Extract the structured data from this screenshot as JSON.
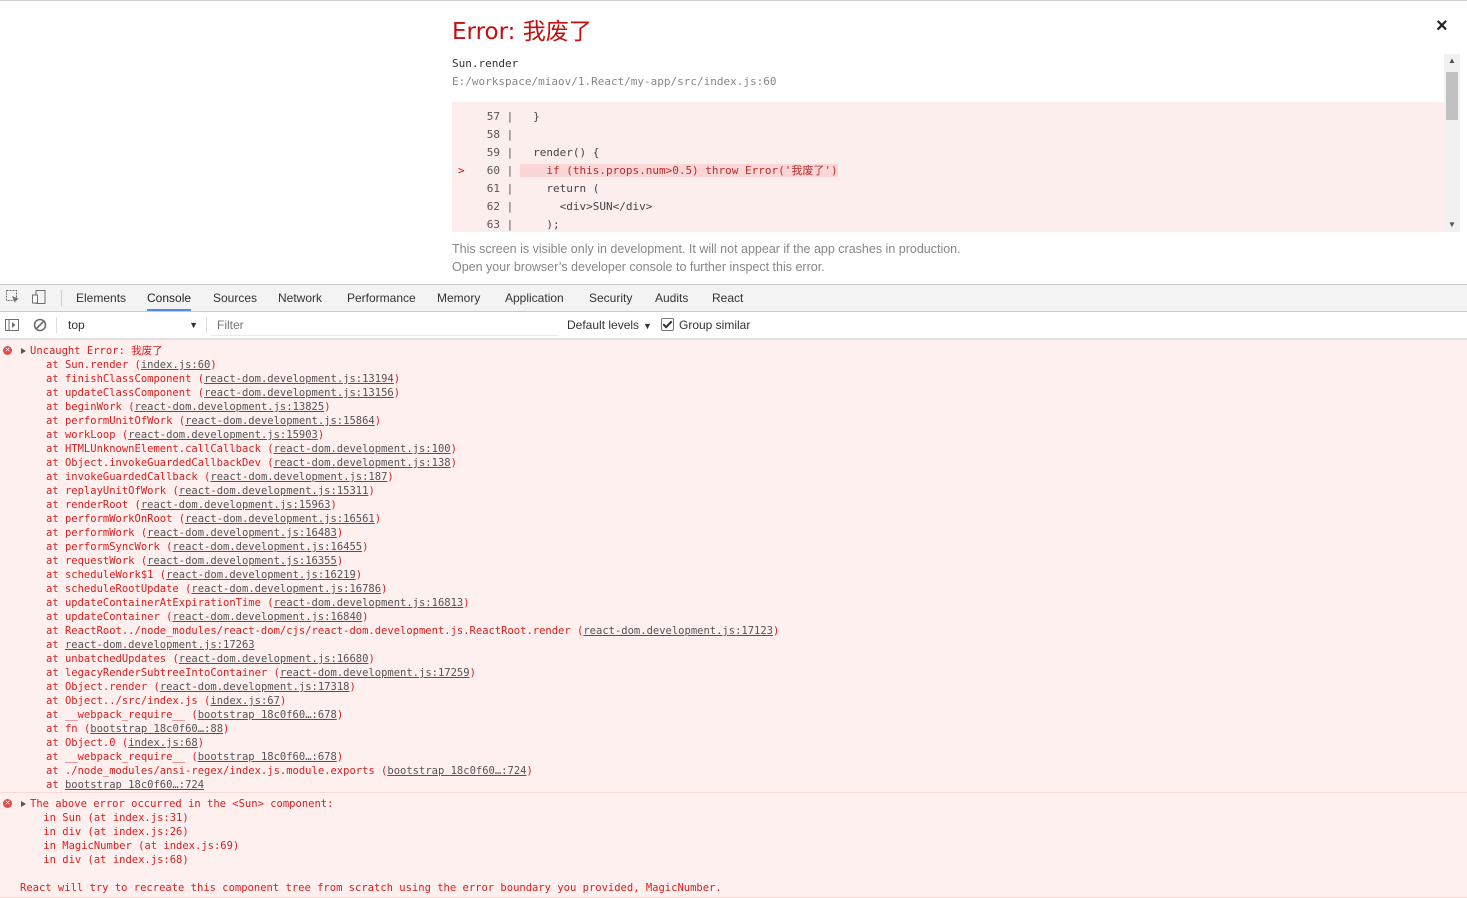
{
  "overlay": {
    "title": "Error: 我废了",
    "close": "×",
    "component": "Sun.render",
    "file": "E:/workspace/miaov/1.React/my-app/src/index.js:60",
    "code": [
      {
        "ln": "57",
        "text": "  }",
        "hl": false
      },
      {
        "ln": "58",
        "text": "",
        "hl": false
      },
      {
        "ln": "59",
        "text": "  render() {",
        "hl": false
      },
      {
        "ln": "60",
        "text": "    if (this.props.num>0.5) throw Error('我废了')",
        "hl": true
      },
      {
        "ln": "61",
        "text": "    return (",
        "hl": false
      },
      {
        "ln": "62",
        "text": "      <div>SUN</div>",
        "hl": false
      },
      {
        "ln": "63",
        "text": "    );",
        "hl": false
      }
    ],
    "note1": "This screen is visible only in development. It will not appear if the app crashes in production.",
    "note2": "Open your browser’s developer console to further inspect this error."
  },
  "devtools": {
    "tabs": [
      "Elements",
      "Console",
      "Sources",
      "Network",
      "Performance",
      "Memory",
      "Application",
      "Security",
      "Audits",
      "React"
    ],
    "active_tab": "Console",
    "context": "top",
    "filter_placeholder": "Filter",
    "levels": "Default levels",
    "group_similar": "Group similar"
  },
  "console": {
    "error1": {
      "head": "Uncaught Error: 我废了",
      "stack": [
        {
          "fn": "Sun.render",
          "loc": "index.js:60"
        },
        {
          "fn": "finishClassComponent",
          "loc": "react-dom.development.js:13194"
        },
        {
          "fn": "updateClassComponent",
          "loc": "react-dom.development.js:13156"
        },
        {
          "fn": "beginWork",
          "loc": "react-dom.development.js:13825"
        },
        {
          "fn": "performUnitOfWork",
          "loc": "react-dom.development.js:15864"
        },
        {
          "fn": "workLoop",
          "loc": "react-dom.development.js:15903"
        },
        {
          "fn": "HTMLUnknownElement.callCallback",
          "loc": "react-dom.development.js:100"
        },
        {
          "fn": "Object.invokeGuardedCallbackDev",
          "loc": "react-dom.development.js:138"
        },
        {
          "fn": "invokeGuardedCallback",
          "loc": "react-dom.development.js:187"
        },
        {
          "fn": "replayUnitOfWork",
          "loc": "react-dom.development.js:15311"
        },
        {
          "fn": "renderRoot",
          "loc": "react-dom.development.js:15963"
        },
        {
          "fn": "performWorkOnRoot",
          "loc": "react-dom.development.js:16561"
        },
        {
          "fn": "performWork",
          "loc": "react-dom.development.js:16483"
        },
        {
          "fn": "performSyncWork",
          "loc": "react-dom.development.js:16455"
        },
        {
          "fn": "requestWork",
          "loc": "react-dom.development.js:16355"
        },
        {
          "fn": "scheduleWork$1",
          "loc": "react-dom.development.js:16219"
        },
        {
          "fn": "scheduleRootUpdate",
          "loc": "react-dom.development.js:16786"
        },
        {
          "fn": "updateContainerAtExpirationTime",
          "loc": "react-dom.development.js:16813"
        },
        {
          "fn": "updateContainer",
          "loc": "react-dom.development.js:16840"
        },
        {
          "fn": "ReactRoot../node_modules/react-dom/cjs/react-dom.development.js.ReactRoot.render",
          "loc": "react-dom.development.js:17123"
        },
        {
          "fn": "",
          "loc": "react-dom.development.js:17263"
        },
        {
          "fn": "unbatchedUpdates",
          "loc": "react-dom.development.js:16680"
        },
        {
          "fn": "legacyRenderSubtreeIntoContainer",
          "loc": "react-dom.development.js:17259"
        },
        {
          "fn": "Object.render",
          "loc": "react-dom.development.js:17318"
        },
        {
          "fn": "Object../src/index.js",
          "loc": "index.js:67"
        },
        {
          "fn": "__webpack_require__",
          "loc": "bootstrap 18c0f60…:678"
        },
        {
          "fn": "fn",
          "loc": "bootstrap 18c0f60…:88"
        },
        {
          "fn": "Object.0",
          "loc": "index.js:68"
        },
        {
          "fn": "__webpack_require__",
          "loc": "bootstrap 18c0f60…:678"
        },
        {
          "fn": "./node_modules/ansi-regex/index.js.module.exports",
          "loc": "bootstrap 18c0f60…:724"
        },
        {
          "fn": "",
          "loc": "bootstrap 18c0f60…:724"
        }
      ]
    },
    "error2": {
      "head": "The above error occurred in the <Sun> component:",
      "lines": [
        "    in Sun (at index.js:31)",
        "    in div (at index.js:26)",
        "    in MagicNumber (at index.js:69)",
        "    in div (at index.js:68)",
        "",
        "React will try to recreate this component tree from scratch using the error boundary you provided, MagicNumber."
      ]
    },
    "colors": {
      "error_text": "#d62020",
      "error_bg": "#fff0f0",
      "overlay_title": "#c40f0f"
    }
  }
}
